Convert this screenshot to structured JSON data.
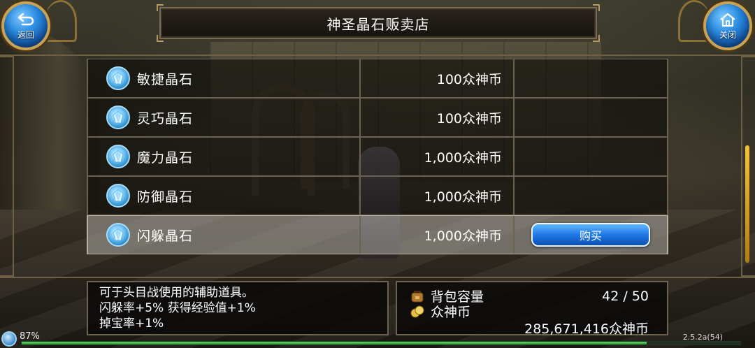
{
  "header": {
    "title": "神圣晶石贩卖店",
    "back_label": "返回",
    "close_label": "关闭"
  },
  "shop": {
    "items": [
      {
        "name": "敏捷晶石",
        "price": "100众神币"
      },
      {
        "name": "灵巧晶石",
        "price": "100众神币"
      },
      {
        "name": "魔力晶石",
        "price": "1,000众神币"
      },
      {
        "name": "防御晶石",
        "price": "1,000众神币"
      },
      {
        "name": "闪躲晶石",
        "price": "1,000众神币",
        "selected": true
      }
    ],
    "buy_label": "购买"
  },
  "description": {
    "lines": [
      "可于头目战使用的辅助道具。",
      "闪躲率+5% 获得经验值+1%",
      "掉宝率+1%"
    ]
  },
  "inventory": {
    "bag_label": "背包容量",
    "bag_value": "42 / 50",
    "currency_label": "众神币",
    "currency_value": "285,671,416众神币"
  },
  "status": {
    "exp_percent": "87%",
    "exp_fraction": 0.87,
    "version": "2.5.2a(54)"
  },
  "colors": {
    "accent_blue": "#1e78e6",
    "frame_gold": "#c9a355",
    "exp_green": "#3fc14f"
  }
}
